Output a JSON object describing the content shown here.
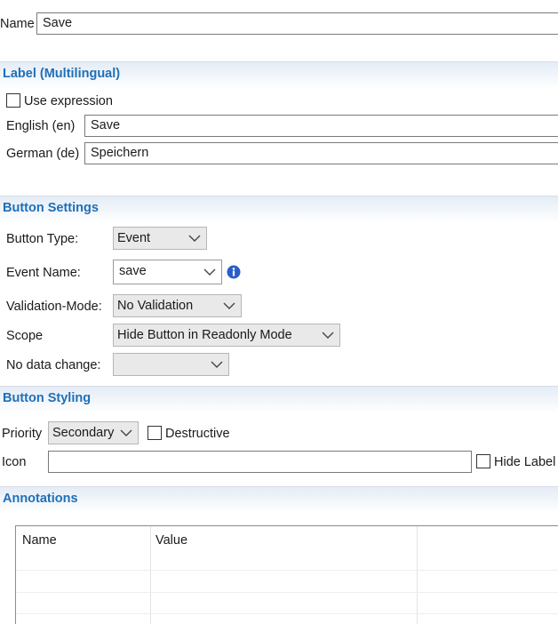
{
  "name_field": {
    "label": "Name",
    "value": "Save"
  },
  "label_section": {
    "title": "Label (Multilingual)",
    "use_expression": "Use expression",
    "english": {
      "label": "English (en)",
      "value": "Save"
    },
    "german": {
      "label": "German (de)",
      "value": "Speichern"
    }
  },
  "button_settings": {
    "title": "Button Settings",
    "button_type": {
      "label": "Button Type:",
      "value": "Event"
    },
    "event_name": {
      "label": "Event Name:",
      "value": "save"
    },
    "validation_mode": {
      "label": "Validation-Mode:",
      "value": "No Validation"
    },
    "scope": {
      "label": "Scope",
      "value": "Hide Button in Readonly Mode"
    },
    "no_data_change": {
      "label": "No data change:",
      "value": ""
    }
  },
  "button_styling": {
    "title": "Button Styling",
    "priority": {
      "label": "Priority",
      "value": "Secondary"
    },
    "destructive": "Destructive",
    "icon": {
      "label": "Icon",
      "value": ""
    },
    "hide_label": "Hide Label"
  },
  "annotations": {
    "title": "Annotations",
    "columns": [
      "Name",
      "Value",
      ""
    ],
    "rows": []
  },
  "colors": {
    "section_title": "#1f6fb8",
    "info_icon": "#2b5fc7"
  },
  "icons": {
    "dropdown": "chevron-down-icon",
    "info": "info-icon"
  }
}
